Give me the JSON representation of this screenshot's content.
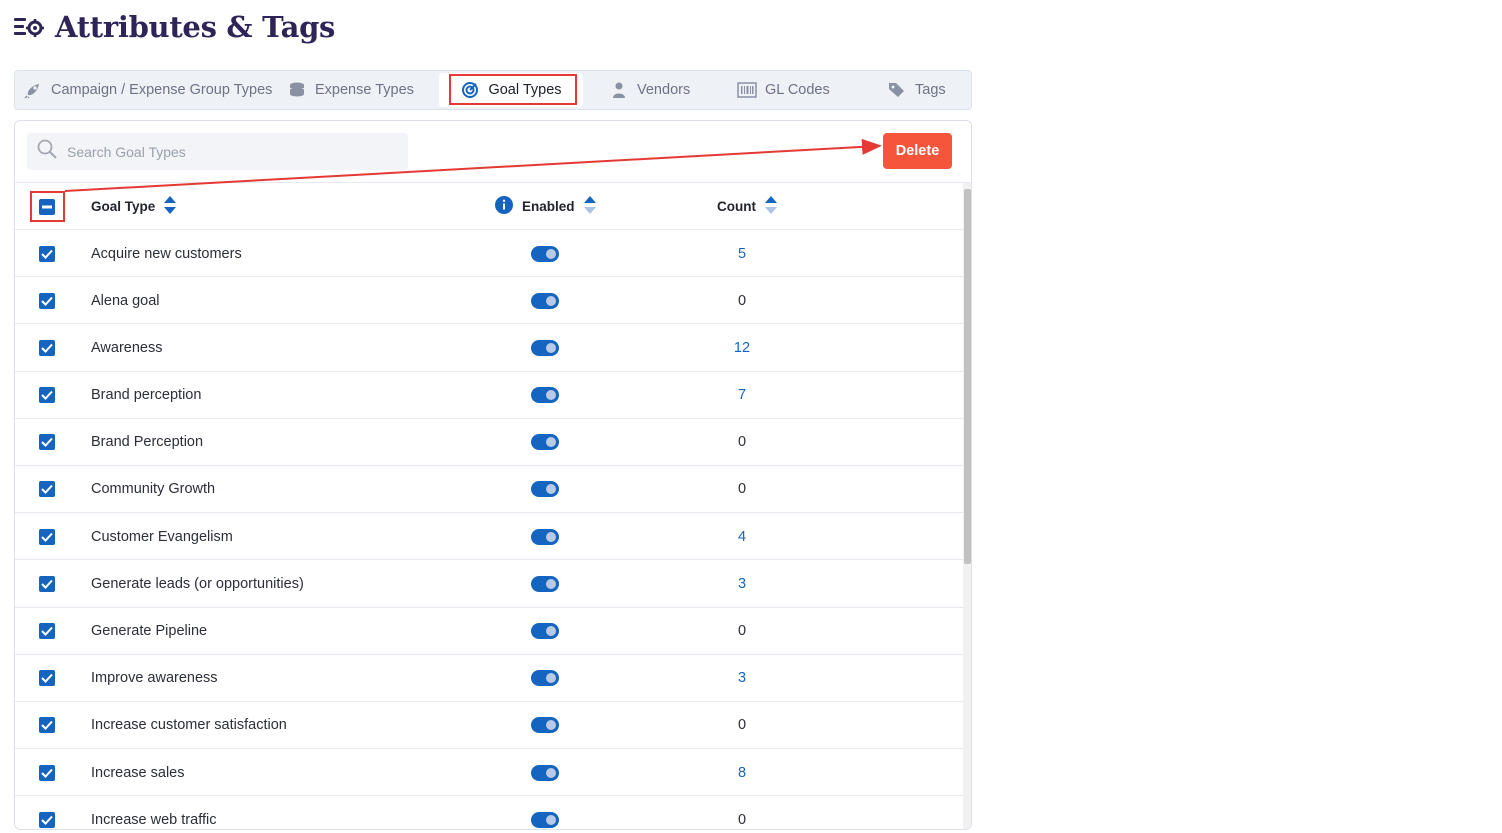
{
  "page": {
    "title": "Attributes & Tags",
    "icon": "list-settings-icon"
  },
  "tabs": [
    {
      "label": "Campaign / Expense Group Types",
      "icon": "rocket-icon",
      "active": false
    },
    {
      "label": "Expense Types",
      "icon": "coins-icon",
      "active": false
    },
    {
      "label": "Goal Types",
      "icon": "target-icon",
      "active": true
    },
    {
      "label": "Vendors",
      "icon": "person-icon",
      "active": false
    },
    {
      "label": "GL Codes",
      "icon": "barcode-icon",
      "active": false
    },
    {
      "label": "Tags",
      "icon": "tags-icon",
      "active": false
    }
  ],
  "toolbar": {
    "search_placeholder": "Search Goal Types",
    "delete_label": "Delete"
  },
  "table": {
    "columns": {
      "goal_type": "Goal Type",
      "enabled": "Enabled",
      "count": "Count"
    },
    "rows": [
      {
        "name": "Acquire new customers",
        "enabled": true,
        "count": "5",
        "link": true,
        "checked": true
      },
      {
        "name": "Alena goal",
        "enabled": true,
        "count": "0",
        "link": false,
        "checked": true
      },
      {
        "name": "Awareness",
        "enabled": true,
        "count": "12",
        "link": true,
        "checked": true
      },
      {
        "name": "Brand perception",
        "enabled": true,
        "count": "7",
        "link": true,
        "checked": true
      },
      {
        "name": "Brand Perception",
        "enabled": true,
        "count": "0",
        "link": false,
        "checked": true
      },
      {
        "name": "Community Growth",
        "enabled": true,
        "count": "0",
        "link": false,
        "checked": true
      },
      {
        "name": "Customer Evangelism",
        "enabled": true,
        "count": "4",
        "link": true,
        "checked": true
      },
      {
        "name": "Generate leads (or opportunities)",
        "enabled": true,
        "count": "3",
        "link": true,
        "checked": true
      },
      {
        "name": "Generate Pipeline",
        "enabled": true,
        "count": "0",
        "link": false,
        "checked": true
      },
      {
        "name": "Improve awareness",
        "enabled": true,
        "count": "3",
        "link": true,
        "checked": true
      },
      {
        "name": "Increase customer satisfaction",
        "enabled": true,
        "count": "0",
        "link": false,
        "checked": true
      },
      {
        "name": "Increase sales",
        "enabled": true,
        "count": "8",
        "link": true,
        "checked": true
      },
      {
        "name": "Increase web traffic",
        "enabled": true,
        "count": "0",
        "link": false,
        "checked": true
      }
    ]
  },
  "colors": {
    "accent": "#1565c0",
    "danger": "#f5553a",
    "annotation": "#e53935",
    "title": "#2e2457"
  }
}
